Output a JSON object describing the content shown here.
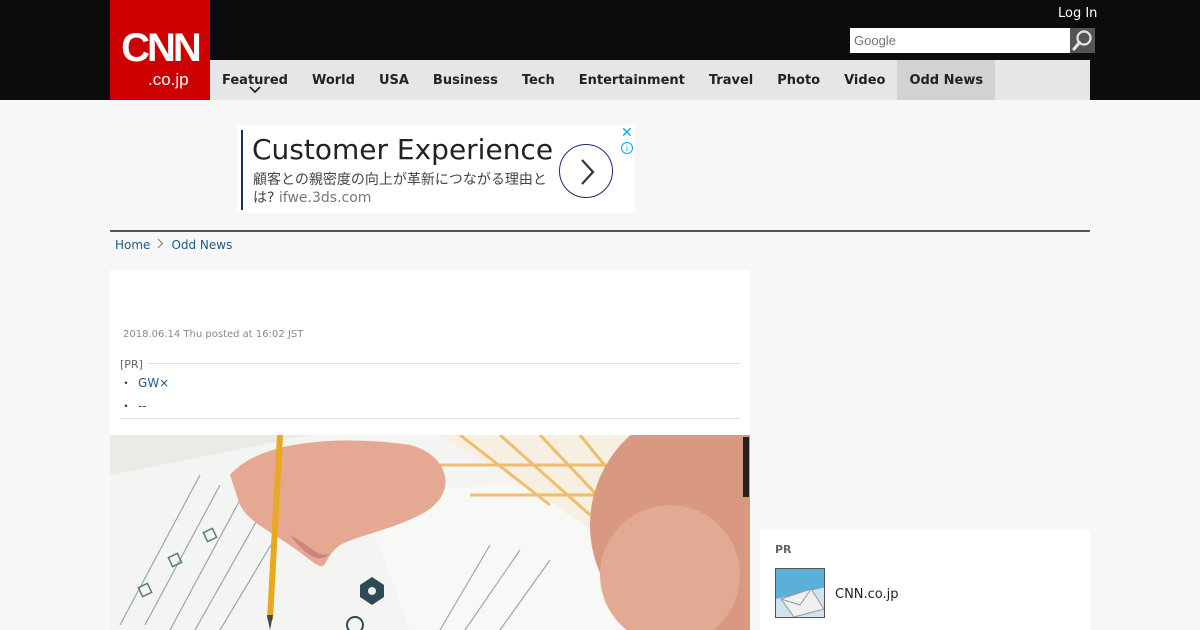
{
  "header": {
    "logo": {
      "line1": "CNN",
      "line2": ".co.jp"
    },
    "login_label": "Log In",
    "search": {
      "placeholder": "Google"
    }
  },
  "nav": {
    "items": [
      {
        "label": "Featured",
        "has_dropdown": true
      },
      {
        "label": "World"
      },
      {
        "label": "USA"
      },
      {
        "label": "Business"
      },
      {
        "label": "Tech"
      },
      {
        "label": "Entertainment"
      },
      {
        "label": "Travel"
      },
      {
        "label": "Photo"
      },
      {
        "label": "Video"
      },
      {
        "label": "Odd News",
        "active": true
      }
    ],
    "dropdown_icon": "chevron-down-icon"
  },
  "ad": {
    "headline": "Customer Experience",
    "body": "顧客との親密度の向上が革新につながる理由とは?",
    "domain": "ifwe.3ds.com",
    "close_glyph": "✕",
    "info_glyph": "i",
    "accent_color": "#1a2b6d"
  },
  "breadcrumb": {
    "home": "Home",
    "current": "Odd News"
  },
  "article": {
    "date": "2018.06.14 Thu posted at 16:02 JST",
    "pr_label": "[PR]",
    "pr_links": [
      {
        "bullet": "・",
        "text": "GW×"
      },
      {
        "bullet": "・",
        "text": "--"
      }
    ],
    "photo_icon": "photo-person-filling-test-sheet"
  },
  "sidebar": {
    "pr_title": "PR",
    "pr_item": {
      "name": "CNN.co.jp",
      "icon": "mail-thumbnail-icon"
    }
  },
  "colors": {
    "brand_red": "#cc0000",
    "header_black": "#0c0c0c",
    "link_blue": "#1a5a8a"
  }
}
